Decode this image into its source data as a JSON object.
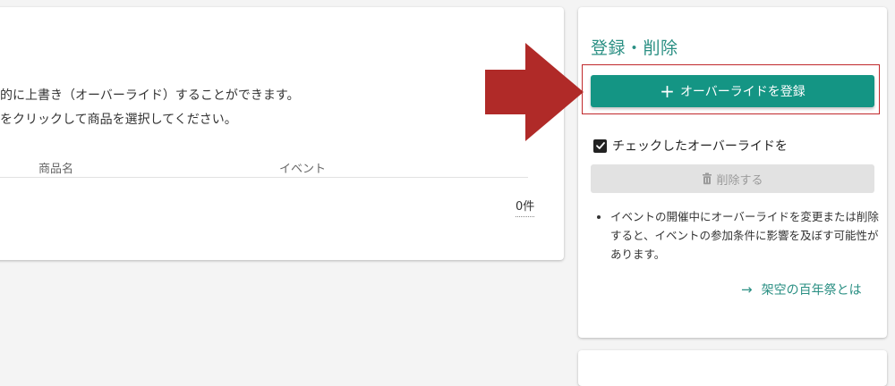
{
  "main": {
    "description_line1": "的に上書き（オーバーライド）することができます。",
    "description_line2": "をクリックして商品を選択してください。",
    "table": {
      "columns": [
        "商品名",
        "イベント"
      ],
      "count": "0件"
    }
  },
  "side": {
    "title": "登録・削除",
    "register_button": {
      "icon": "plus-icon",
      "label": "オーバーライドを登録"
    },
    "checkbox_label": "チェックしたオーバーライドを",
    "delete_button": {
      "icon": "trash-icon",
      "label": "削除する"
    },
    "notes": [
      "イベントの開催中にオーバーライドを変更または削除すると、イベントの参加条件に影響を及ぼす可能性があります。"
    ],
    "about_link": {
      "icon": "arrow-right-icon",
      "label": "架空の百年祭とは"
    }
  },
  "colors": {
    "accent": "#149584",
    "accent_text": "#2a8f83",
    "annotation_red": "#b02a28",
    "disabled": "#e2e2e2"
  }
}
